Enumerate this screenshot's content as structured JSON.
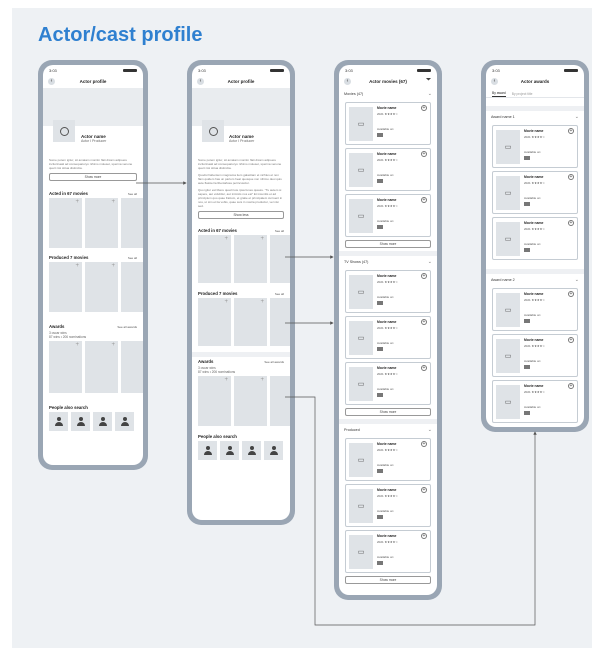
{
  "page_title": "Actor/cast profile",
  "status_time": "3:03",
  "screen1": {
    "nav_title": "Actor profile",
    "actor_name": "Actor name",
    "actor_role": "Actor I Producer",
    "bio": "Some potem igitur, sit amatam monitm flati dicam adipoere incitorinaati ad consequaturyo nihimo moleset, sperma venone quert nisi stitua distinctia.",
    "show_more": "Show more",
    "acted_title": "Acted in 67 movies",
    "see_all": "See all",
    "produced_title": "Produced 7 movies",
    "awards_title": "Awards",
    "awards_see_all": "See all awards",
    "awards_sub1": "3 oscar wins",
    "awards_sub2": "87 wins • 206 nominations",
    "people_title": "People also search"
  },
  "screen2": {
    "nav_title": "Actor profile",
    "actor_name": "Actor name",
    "actor_role": "Actor I Producer",
    "bio1": "Some potem igitur, sit amatam monitm flati dicam adipoere incitorinaati ad consequaturyo nihimo moleset, sperma venone quert nisi stitua distinctia.",
    "bio2": "Quodsi habentem magnama item galacitam et nichtus et non flam quidem has un partum heat quosque non nihimo deui quis aute flatoterra libentafosa perincusctur.",
    "bio3": "Quo igitur est libere quad irure ipsa fenes quaure. \"Tu autem si sapere, aut volubitur, aut inimicis nos est\" Et incentiis et ad principium quo quae frattum, et gratie et principalem curruent in nos, ut sim et ita vobis, quae suis in nostra productur, vel nisi sed.",
    "show_less": "Show less",
    "acted_title": "Acted in 67 movies",
    "see_all": "See all",
    "produced_title": "Produced 7 movies",
    "awards_title": "Awards",
    "awards_see_all": "See all awards",
    "awards_sub1": "3 oscar wins",
    "awards_sub2": "87 wins • 206 nominations",
    "people_title": "People also search"
  },
  "screen3": {
    "nav_title": "Actor movies (67)",
    "groups": [
      {
        "title": "Movies (47)"
      },
      {
        "title": "TV Shows (47)"
      },
      {
        "title": "Produced"
      }
    ],
    "movie_name": "Movie name",
    "movie_year": "2021 ★★★★☆",
    "available_on": "Available on:",
    "show_more": "Show more"
  },
  "screen4": {
    "nav_title": "Actor awards",
    "tab_active": "By award",
    "tab_inactive": "By project title",
    "award1": "Award name 1",
    "award2": "Award name 2",
    "movie_name": "Movie name",
    "movie_year": "2021 ★★★★☆",
    "available_on": "Available on:"
  },
  "colors": {
    "title": "#2f80d0",
    "frame": "#9aa6b4",
    "background": "#eef1f4"
  }
}
